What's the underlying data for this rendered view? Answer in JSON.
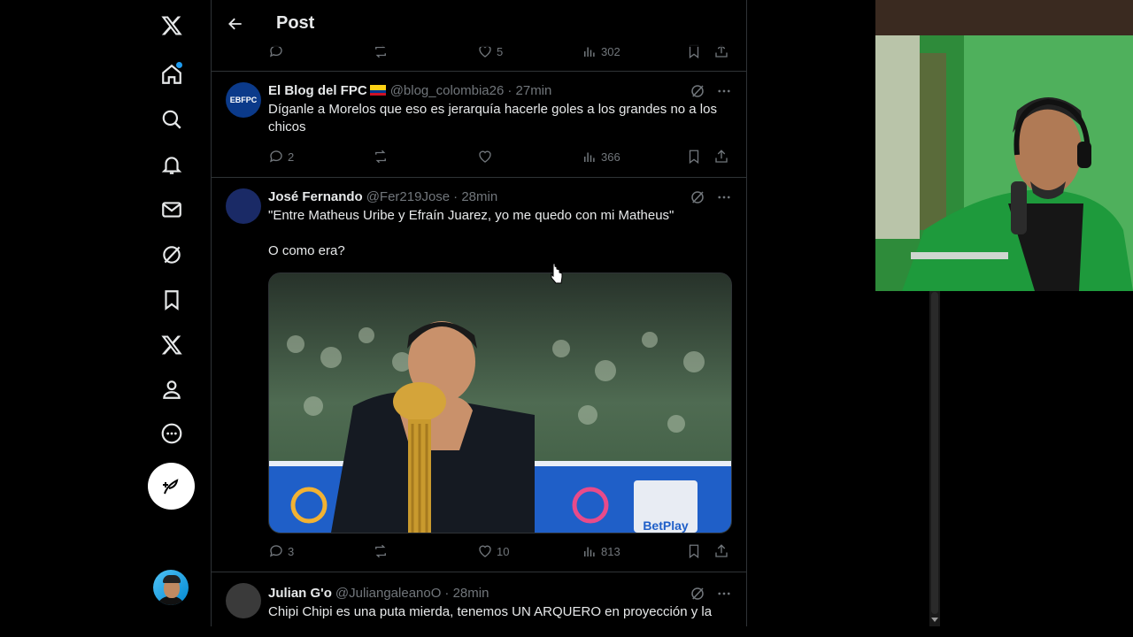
{
  "header": {
    "title": "Post"
  },
  "sidebar": {
    "items": [
      {
        "icon": "x-logo-icon"
      },
      {
        "icon": "home-icon"
      },
      {
        "icon": "search-icon"
      },
      {
        "icon": "notifications-icon"
      },
      {
        "icon": "messages-icon"
      },
      {
        "icon": "grok-icon"
      },
      {
        "icon": "bookmarks-icon"
      },
      {
        "icon": "premium-x-icon"
      },
      {
        "icon": "profile-icon"
      },
      {
        "icon": "more-icon"
      }
    ],
    "compose_icon": "compose-icon"
  },
  "top_actions": {
    "replies": "",
    "reposts": "",
    "likes": "5",
    "views": "302"
  },
  "tweets": [
    {
      "name": "El Blog del FPC",
      "handle": "@blog_colombia26",
      "time": "· 27min",
      "avatar_text": "EBFPC",
      "text": "Díganle a Morelos que eso es jerarquía hacerle goles a los grandes no a los chicos",
      "replies": "2",
      "reposts": "",
      "likes": "",
      "views": "366"
    },
    {
      "name": "José Fernando",
      "handle": "@Fer219Jose",
      "time": "· 28min",
      "text_line1": "\"Entre Matheus Uribe y Efraín Juarez, yo me quedo con mi Matheus\"",
      "text_line2": "O como era?",
      "replies": "3",
      "reposts": "",
      "likes": "10",
      "views": "813"
    },
    {
      "name": "Julian G'o",
      "handle": "@JuliangaleanoO",
      "time": "· 28min",
      "text": "Chipi Chipi es una puta mierda, tenemos UN ARQUERO en proyección y la"
    }
  ],
  "media": {
    "banner_text": "BetPlay"
  },
  "colors": {
    "accent": "#1d9bf0",
    "muted": "#71767b",
    "border": "#2f3336"
  }
}
